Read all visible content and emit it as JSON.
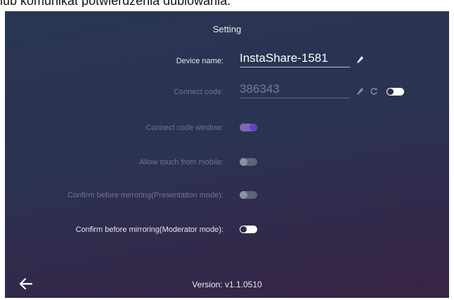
{
  "caption": "lub komunikat potwierdzenia dublowania.",
  "screen_title": "Setting",
  "device_name": {
    "label": "Device name:",
    "value": "InstaShare-1581",
    "edit_icon": "pencil-icon"
  },
  "connect_code": {
    "label": "Connect code:",
    "value": "386343",
    "edit_icon": "pencil-icon",
    "refresh_icon": "refresh-icon",
    "toggle_state": "off"
  },
  "settings": [
    {
      "label": "Connect code window:",
      "state": "on",
      "enabled": false
    },
    {
      "label": "Allow touch from mobile:",
      "state": "off",
      "enabled": false
    },
    {
      "label": "Confirm before mirroring(Presentation mode):",
      "state": "off",
      "enabled": false
    },
    {
      "label": "Confirm before mirroring(Moderator mode):",
      "state": "off",
      "enabled": true
    }
  ],
  "version": "Version: v1.1.0510",
  "back_icon": "arrow-left-icon",
  "colors": {
    "accent": "#6a3fc4",
    "background_top": "#283652",
    "background_bottom": "#3a2445"
  }
}
